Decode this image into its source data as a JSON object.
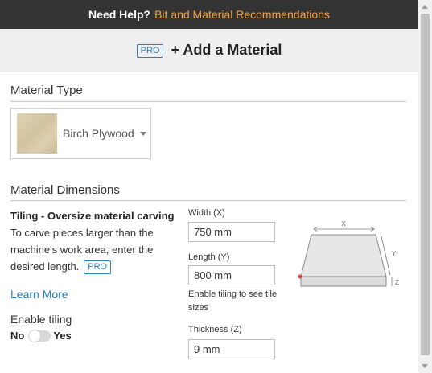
{
  "help_bar": {
    "label": "Need Help?",
    "link": "Bit and Material Recommendations"
  },
  "header": {
    "badge": "PRO",
    "title": "+ Add a Material"
  },
  "material_type": {
    "section_title": "Material Type",
    "selected": "Birch Plywood"
  },
  "dimensions": {
    "section_title": "Material Dimensions",
    "tiling": {
      "title": "Tiling - Oversize material carving",
      "description": "To carve pieces larger than the machine's work area, enter the desired length.",
      "badge": "PRO",
      "learn_more": "Learn More",
      "enable_label": "Enable tiling",
      "toggle_off": "No",
      "toggle_on": "Yes",
      "enabled": false
    },
    "width": {
      "label": "Width (X)",
      "value": "750 mm"
    },
    "length": {
      "label": "Length (Y)",
      "value": "800 mm",
      "note": "Enable tiling to see tile sizes"
    },
    "thickness": {
      "label": "Thickness (Z)",
      "value": "9 mm"
    },
    "diagram": {
      "x_label": "X",
      "y_label": "Y",
      "z_label": "Z"
    }
  },
  "colors": {
    "accent": "#2d7fb8",
    "link_orange": "#f7a23e",
    "help_bar_bg": "#333333"
  }
}
